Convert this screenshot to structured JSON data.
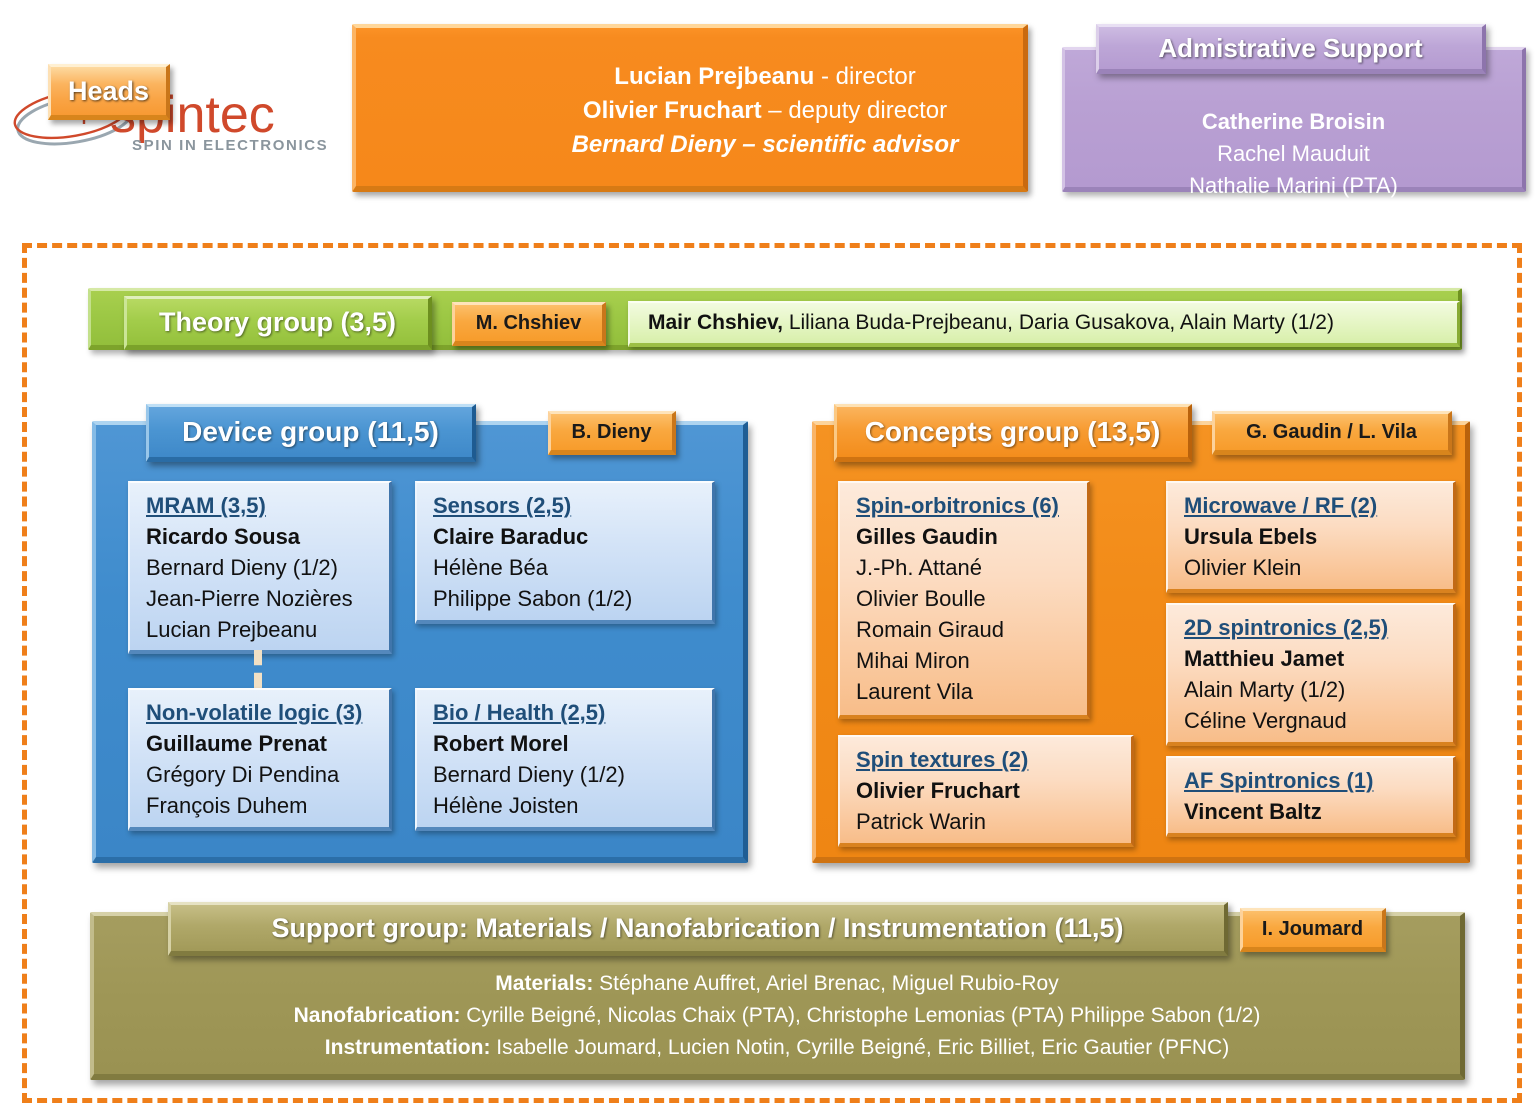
{
  "logo": {
    "name": "spintec",
    "tagline": "SPIN IN ELECTRONICS"
  },
  "heads": {
    "tag_label": "Heads",
    "lines": [
      {
        "name": "Lucian Prejbeanu",
        "sep": " - ",
        "role": "director",
        "italic": false
      },
      {
        "name": "Olivier Fruchart",
        "sep": " – ",
        "role": "deputy director",
        "italic": false
      },
      {
        "name": "Bernard Dieny",
        "sep": " – ",
        "role": "scientific advisor",
        "italic": true
      }
    ]
  },
  "admin": {
    "title": "Admistrative Support",
    "members": [
      "Catherine Broisin",
      "Rachel Mauduit",
      "Nathalie Marini (PTA)"
    ]
  },
  "theory": {
    "title": "Theory group (3,5)",
    "lead_tag": "M. Chshiev",
    "members_lead": "Mair Chshiev,",
    "members_rest": " Liliana Buda-Prejbeanu, Daria Gusakova, Alain Marty (1/2)"
  },
  "device": {
    "title": "Device group (11,5)",
    "lead_tag": "B. Dieny",
    "subgroups": [
      {
        "title": "MRAM (3,5)",
        "lead": "Ricardo Sousa",
        "members": [
          "Bernard Dieny (1/2)",
          "Jean-Pierre Nozières",
          "Lucian Prejbeanu"
        ]
      },
      {
        "title": "Sensors (2,5)",
        "lead": "Claire Baraduc",
        "members": [
          "Hélène Béa",
          "Philippe Sabon (1/2)"
        ]
      },
      {
        "title": "Non-volatile logic (3)",
        "lead": "Guillaume Prenat",
        "members": [
          "Grégory Di Pendina",
          "François Duhem"
        ]
      },
      {
        "title": "Bio / Health (2,5)",
        "lead": "Robert Morel",
        "members": [
          "Bernard Dieny (1/2)",
          "Hélène Joisten"
        ]
      }
    ]
  },
  "concepts": {
    "title": "Concepts group (13,5)",
    "lead_tag": "G. Gaudin / L. Vila",
    "subgroups": [
      {
        "title": "Spin-orbitronics (6)",
        "lead": "Gilles Gaudin",
        "members": [
          "J.-Ph. Attané",
          "Olivier Boulle",
          "Romain Giraud",
          "Mihai Miron",
          "Laurent Vila"
        ]
      },
      {
        "title": "Microwave / RF (2)",
        "lead": "Ursula Ebels",
        "members": [
          "Olivier Klein"
        ]
      },
      {
        "title": "2D spintronics (2,5)",
        "lead": "Matthieu Jamet",
        "members": [
          "Alain Marty (1/2)",
          "Céline Vergnaud"
        ]
      },
      {
        "title": "Spin textures (2)",
        "lead": "Olivier Fruchart",
        "members": [
          "Patrick Warin"
        ]
      },
      {
        "title": "AF Spintronics (1)",
        "lead": "Vincent Baltz",
        "members": []
      }
    ]
  },
  "support": {
    "title": "Support group: Materials / Nanofabrication / Instrumentation (11,5)",
    "lead_tag": "I. Joumard",
    "lines": [
      {
        "label": "Materials:",
        "people": " Stéphane Auffret, Ariel Brenac, Miguel Rubio-Roy"
      },
      {
        "label": "Nanofabrication:",
        "people": " Cyrille Beigné, Nicolas Chaix (PTA), Christophe Lemonias (PTA) Philippe Sabon (1/2)"
      },
      {
        "label": "Instrumentation:",
        "people": " Isabelle Joumard, Lucien Notin, Cyrille Beigné, Eric Billiet, Eric Gautier (PFNC)"
      }
    ]
  },
  "colors": {
    "heads_orange": "#f6881a",
    "admin_purple": "#b49ad0",
    "theory_green": "#93bf3c",
    "device_blue": "#3b86c7",
    "concepts_orange": "#ef8613",
    "support_olive": "#9a9252",
    "dashed_border": "#ef7f1a"
  }
}
